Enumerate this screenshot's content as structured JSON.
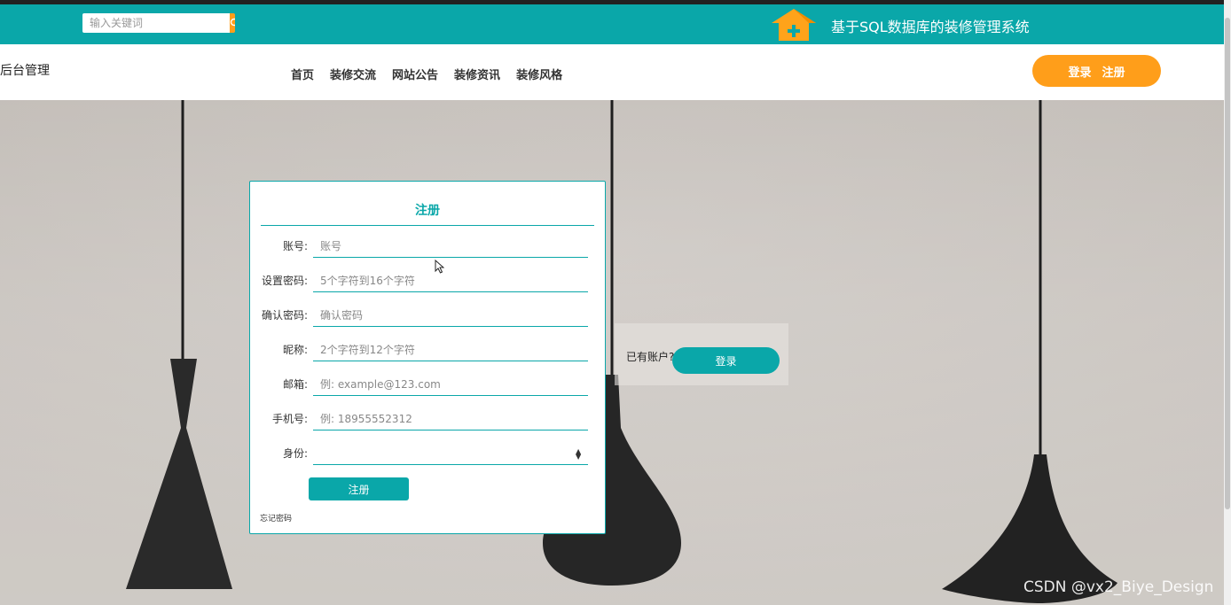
{
  "header": {
    "search_placeholder": "输入关键词",
    "site_title": "基于SQL数据库的装修管理系统",
    "accent_color": "#0aa7a9",
    "orange_color": "#ff9e1a"
  },
  "nav": {
    "brand": "后台管理",
    "items": [
      "首页",
      "装修交流",
      "网站公告",
      "装修资讯",
      "装修风格"
    ],
    "login_label": "登录",
    "register_label": "注册"
  },
  "form": {
    "title": "注册",
    "fields": [
      {
        "label": "账号:",
        "placeholder": "账号"
      },
      {
        "label": "设置密码:",
        "placeholder": "5个字符到16个字符"
      },
      {
        "label": "确认密码:",
        "placeholder": "确认密码"
      },
      {
        "label": "昵称:",
        "placeholder": "2个字符到12个字符"
      },
      {
        "label": "邮箱:",
        "placeholder": "例: example@123.com"
      },
      {
        "label": "手机号:",
        "placeholder": "例: 18955552312"
      },
      {
        "label": "身份:",
        "placeholder": ""
      }
    ],
    "submit_label": "注册",
    "forgot_label": "忘记密码"
  },
  "login_prompt": {
    "text": "已有账户?",
    "button": "登录"
  },
  "watermark": "CSDN @vx2_Biye_Design"
}
